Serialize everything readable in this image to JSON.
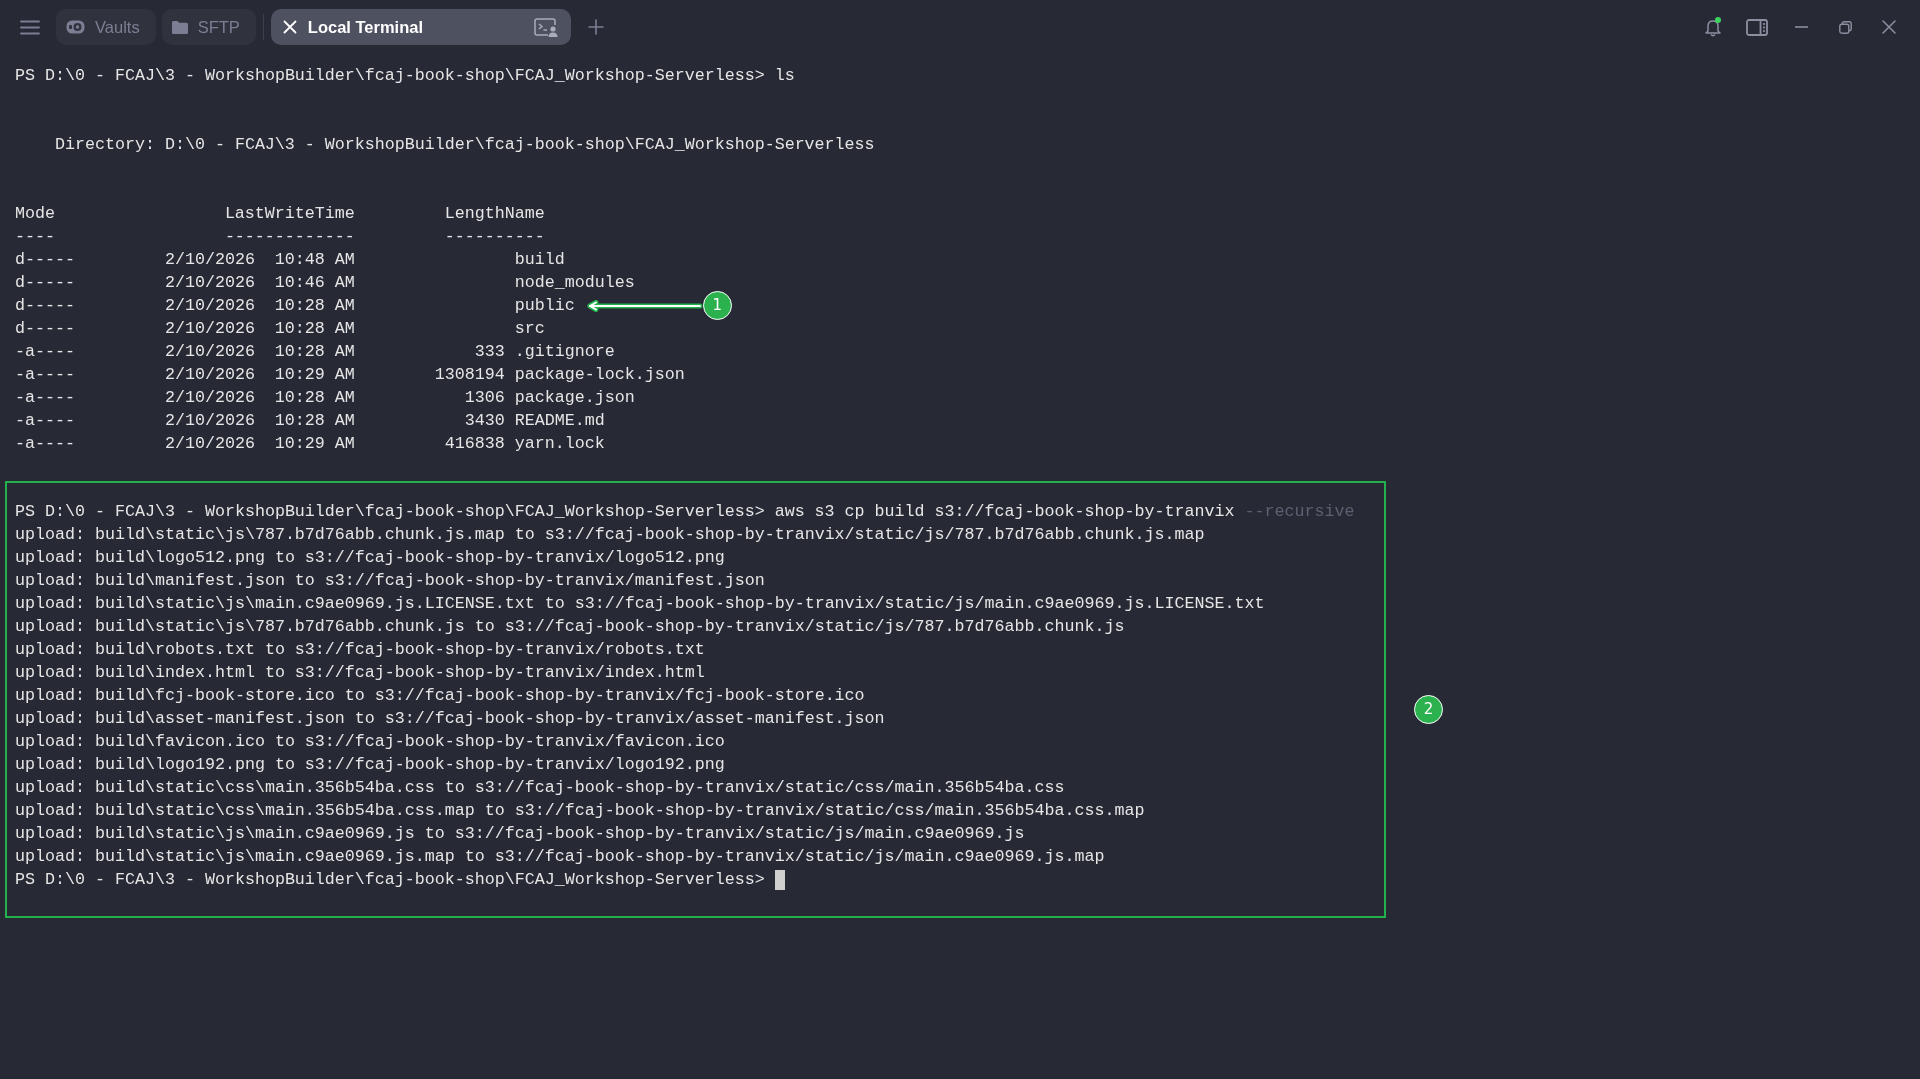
{
  "tabs": [
    {
      "label": "Vaults",
      "kind": "vaults",
      "selected": false
    },
    {
      "label": "SFTP",
      "kind": "sftp",
      "selected": false
    },
    {
      "label": "Local Terminal",
      "kind": "terminal",
      "selected": true
    }
  ],
  "notifications": {
    "unread": true
  },
  "terminal": {
    "ls_prompt": "PS D:\\0 - FCAJ\\3 - WorkshopBuilder\\fcaj-book-shop\\FCAJ_Workshop-Serverless>",
    "ls_command": "ls",
    "directory": "Directory: D:\\0 - FCAJ\\3 - WorkshopBuilder\\fcaj-book-shop\\FCAJ_Workshop-Serverless",
    "columns": [
      {
        "heading": "Mode",
        "rule": "----"
      },
      {
        "heading": "LastWriteTime",
        "rule": "-------------"
      },
      {
        "heading": "Length",
        "rule": "------"
      },
      {
        "heading": "Name",
        "rule": "----"
      }
    ],
    "rows": [
      {
        "mode": "d-----",
        "last_write_time": "2/10/2026  10:48 AM",
        "name": "build"
      },
      {
        "mode": "d-----",
        "last_write_time": "2/10/2026  10:46 AM",
        "name": "node_modules"
      },
      {
        "mode": "d-----",
        "last_write_time": "2/10/2026  10:28 AM",
        "name": "public",
        "callout": "1"
      },
      {
        "mode": "d-----",
        "last_write_time": "2/10/2026  10:28 AM",
        "name": "src"
      },
      {
        "mode": "-a----",
        "last_write_time": "2/10/2026  10:28 AM",
        "length": "333",
        "name": ".gitignore"
      },
      {
        "mode": "-a----",
        "last_write_time": "2/10/2026  10:29 AM",
        "length": "1308194",
        "name": "package-lock.json"
      },
      {
        "mode": "-a----",
        "last_write_time": "2/10/2026  10:28 AM",
        "length": "1306",
        "name": "package.json"
      },
      {
        "mode": "-a----",
        "last_write_time": "2/10/2026  10:28 AM",
        "length": "3430",
        "name": "README.md"
      },
      {
        "mode": "-a----",
        "last_write_time": "2/10/2026  10:29 AM",
        "length": "416838",
        "name": "yarn.lock"
      }
    ],
    "highlight_box": {
      "callout": "2",
      "prompt": "PS D:\\0 - FCAJ\\3 - WorkshopBuilder\\fcaj-book-shop\\FCAJ_Workshop-Serverless>",
      "command": "aws s3 cp build s3://fcaj-book-shop-by-tranvix",
      "parameter": "--recursive",
      "uploads": [
        "upload: build\\static\\js\\787.b7d76abb.chunk.js.map to s3://fcaj-book-shop-by-tranvix/static/js/787.b7d76abb.chunk.js.map",
        "upload: build\\logo512.png to s3://fcaj-book-shop-by-tranvix/logo512.png",
        "upload: build\\manifest.json to s3://fcaj-book-shop-by-tranvix/manifest.json",
        "upload: build\\static\\js\\main.c9ae0969.js.LICENSE.txt to s3://fcaj-book-shop-by-tranvix/static/js/main.c9ae0969.js.LICENSE.txt",
        "upload: build\\static\\js\\787.b7d76abb.chunk.js to s3://fcaj-book-shop-by-tranvix/static/js/787.b7d76abb.chunk.js",
        "upload: build\\robots.txt to s3://fcaj-book-shop-by-tranvix/robots.txt",
        "upload: build\\index.html to s3://fcaj-book-shop-by-tranvix/index.html",
        "upload: build\\fcj-book-store.ico to s3://fcaj-book-shop-by-tranvix/fcj-book-store.ico",
        "upload: build\\asset-manifest.json to s3://fcaj-book-shop-by-tranvix/asset-manifest.json",
        "upload: build\\favicon.ico to s3://fcaj-book-shop-by-tranvix/favicon.ico",
        "upload: build\\logo192.png to s3://fcaj-book-shop-by-tranvix/logo192.png",
        "upload: build\\static\\css\\main.356b54ba.css to s3://fcaj-book-shop-by-tranvix/static/css/main.356b54ba.css",
        "upload: build\\static\\css\\main.356b54ba.css.map to s3://fcaj-book-shop-by-tranvix/static/css/main.356b54ba.css.map",
        "upload: build\\static\\js\\main.c9ae0969.js to s3://fcaj-book-shop-by-tranvix/static/js/main.c9ae0969.js",
        "upload: build\\static\\js\\main.c9ae0969.js.map to s3://fcaj-book-shop-by-tranvix/static/js/main.c9ae0969.js.map"
      ],
      "final_prompt": "PS D:\\0 - FCAJ\\3 - WorkshopBuilder\\fcaj-book-shop\\FCAJ_Workshop-Serverless>"
    }
  }
}
